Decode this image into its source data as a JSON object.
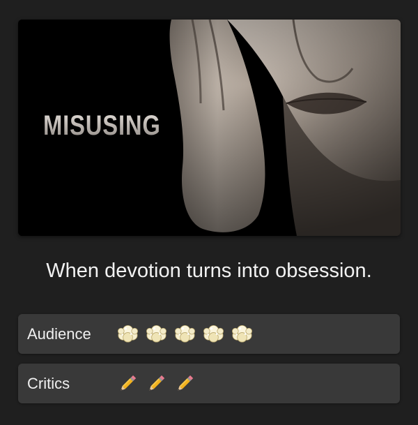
{
  "poster": {
    "title": "MISUSING",
    "image": "woman-face-hand-portrait"
  },
  "tagline": "When devotion turns into obsession.",
  "ratings": {
    "audience": {
      "label": "Audience",
      "icon": "popcorn-icon",
      "count": 5
    },
    "critics": {
      "label": "Critics",
      "icon": "pencil-icon",
      "count": 3
    }
  },
  "colors": {
    "background": "#1f1f1f",
    "row": "#393939",
    "text": "#f0f0f0"
  }
}
